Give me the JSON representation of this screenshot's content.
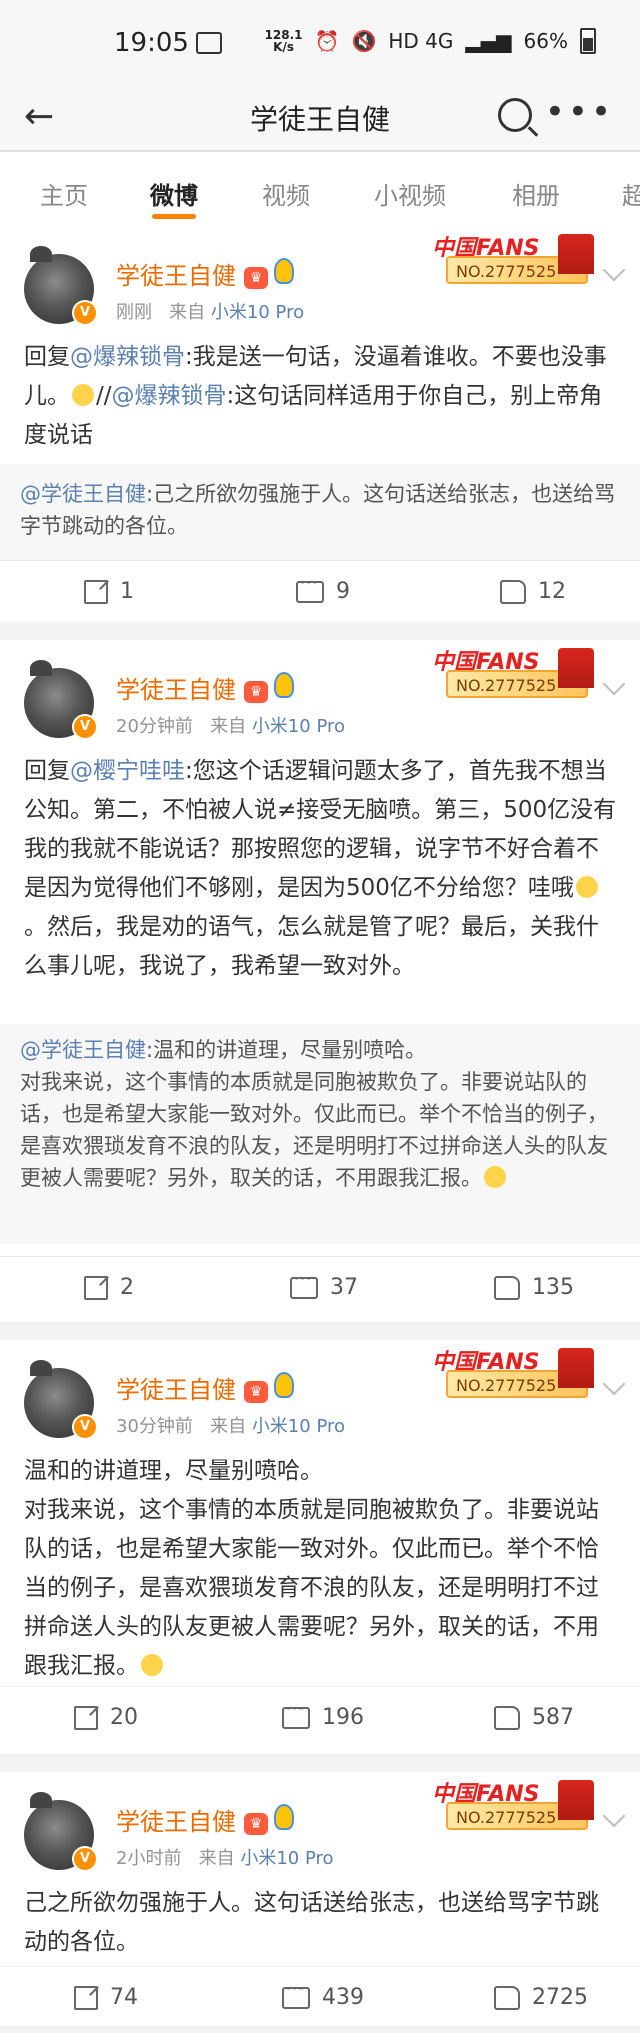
{
  "status_bar": {
    "time": "19:05",
    "speed_top": "128.1",
    "speed_bottom": "K/s",
    "network": "HD 4G",
    "battery": "66%"
  },
  "nav": {
    "title": "学徒王自健"
  },
  "tabs": [
    "主页",
    "微博",
    "视频",
    "小视频",
    "相册",
    "超"
  ],
  "posts": [
    {
      "user": "学徒王自健",
      "time": "刚刚",
      "source_prefix": "来自",
      "source": "小米10 Pro",
      "fans_banner": "中国FANS",
      "fans_no": "NO.2777525",
      "content_a": "回复",
      "mention_1": "@爆辣锁骨",
      "content_b": ":我是送一句话，没逼着谁收。不要也没事儿。",
      "sep": "//",
      "mention_2": "@爆辣锁骨",
      "content_c": ":这句话同样适用于你自己，别上帝角度说话",
      "quote_user": "@学徒王自健",
      "quote_text": ":己之所欲勿强施于人。这句话送给张志，也送给骂字节跳动的各位。",
      "reposts": "1",
      "comments": "9",
      "likes": "12"
    },
    {
      "user": "学徒王自健",
      "time": "20分钟前",
      "source_prefix": "来自",
      "source": "小米10 Pro",
      "fans_banner": "中国FANS",
      "fans_no": "NO.2777525",
      "content_a": "回复",
      "mention_1": "@樱宁哇哇",
      "content_b": ":您这个话逻辑问题太多了，首先我不想当公知。第二，不怕被人说≠接受无脑喷。第三，500亿没有我的我就不能说话？那按照您的逻辑，说字节不好合着不是因为觉得他们不够刚，是因为500亿不分给您？哇哦",
      "content_c": "。然后，我是劝的语气，怎么就是管了呢？最后，关我什么事儿呢，我说了，我希望一致对外。",
      "quote_user": "@学徒王自健",
      "quote_text": ":温和的讲道理，尽量别喷哈。",
      "quote_text_2": "对我来说，这个事情的本质就是同胞被欺负了。非要说站队的话，也是希望大家能一致对外。仅此而已。举个不恰当的例子，是喜欢猥琐发育不浪的队友，还是明明打不过拼命送人头的队友更被人需要呢？另外，取关的话，不用跟我汇报。",
      "reposts": "2",
      "comments": "37",
      "likes": "135"
    },
    {
      "user": "学徒王自健",
      "time": "30分钟前",
      "source_prefix": "来自",
      "source": "小米10 Pro",
      "fans_banner": "中国FANS",
      "fans_no": "NO.2777525",
      "line_1": "温和的讲道理，尽量别喷哈。",
      "line_2": "对我来说，这个事情的本质就是同胞被欺负了。非要说站队的话，也是希望大家能一致对外。仅此而已。举个不恰当的例子，是喜欢猥琐发育不浪的队友，还是明明打不过拼命送人头的队友更被人需要呢？另外，取关的话，不用跟我汇报。",
      "reposts": "20",
      "comments": "196",
      "likes": "587"
    },
    {
      "user": "学徒王自健",
      "time": "2小时前",
      "source_prefix": "来自",
      "source": "小米10 Pro",
      "fans_banner": "中国FANS",
      "fans_no": "NO.2777525",
      "line_1": "己之所欲勿强施于人。这句话送给张志，也送给骂字节跳动的各位。",
      "reposts": "74",
      "comments": "439",
      "likes": "2725"
    }
  ]
}
